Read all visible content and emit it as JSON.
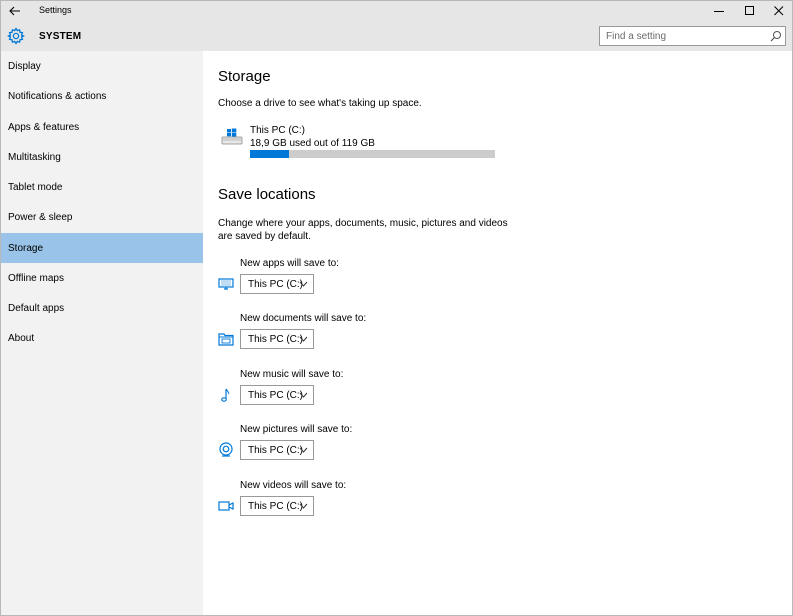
{
  "window": {
    "title": "Settings",
    "controls": {
      "minimize": "minimize-icon",
      "maximize": "maximize-icon",
      "close": "close-icon"
    }
  },
  "header": {
    "section": "SYSTEM",
    "search": {
      "placeholder": "Find a setting",
      "value": ""
    }
  },
  "sidebar": {
    "items": [
      {
        "label": "Display",
        "selected": false
      },
      {
        "label": "Notifications & actions",
        "selected": false
      },
      {
        "label": "Apps & features",
        "selected": false
      },
      {
        "label": "Multitasking",
        "selected": false
      },
      {
        "label": "Tablet mode",
        "selected": false
      },
      {
        "label": "Power & sleep",
        "selected": false
      },
      {
        "label": "Storage",
        "selected": true
      },
      {
        "label": "Offline maps",
        "selected": false
      },
      {
        "label": "Default apps",
        "selected": false
      },
      {
        "label": "About",
        "selected": false
      }
    ]
  },
  "storage": {
    "title": "Storage",
    "description": "Choose a drive to see what's taking up space.",
    "drive": {
      "name": "This PC (C:)",
      "usage_text": "18,9 GB used out of 119 GB",
      "used_fraction": 0.159
    }
  },
  "save_locations": {
    "title": "Save locations",
    "description": "Change where your apps, documents, music, pictures and videos are saved by default.",
    "items": [
      {
        "label": "New apps will save to:",
        "value": "This PC (C:)",
        "icon": "monitor-icon"
      },
      {
        "label": "New documents will save to:",
        "value": "This PC (C:)",
        "icon": "folder-icon"
      },
      {
        "label": "New music will save to:",
        "value": "This PC (C:)",
        "icon": "music-note-icon"
      },
      {
        "label": "New pictures will save to:",
        "value": "This PC (C:)",
        "icon": "camera-icon"
      },
      {
        "label": "New videos will save to:",
        "value": "This PC (C:)",
        "icon": "video-camera-icon"
      }
    ]
  },
  "colors": {
    "accent": "#0078d7",
    "selected_nav": "#99c3e8",
    "sidebar_bg": "#f2f2f2",
    "titlebar_bg": "#e6e6e6"
  }
}
